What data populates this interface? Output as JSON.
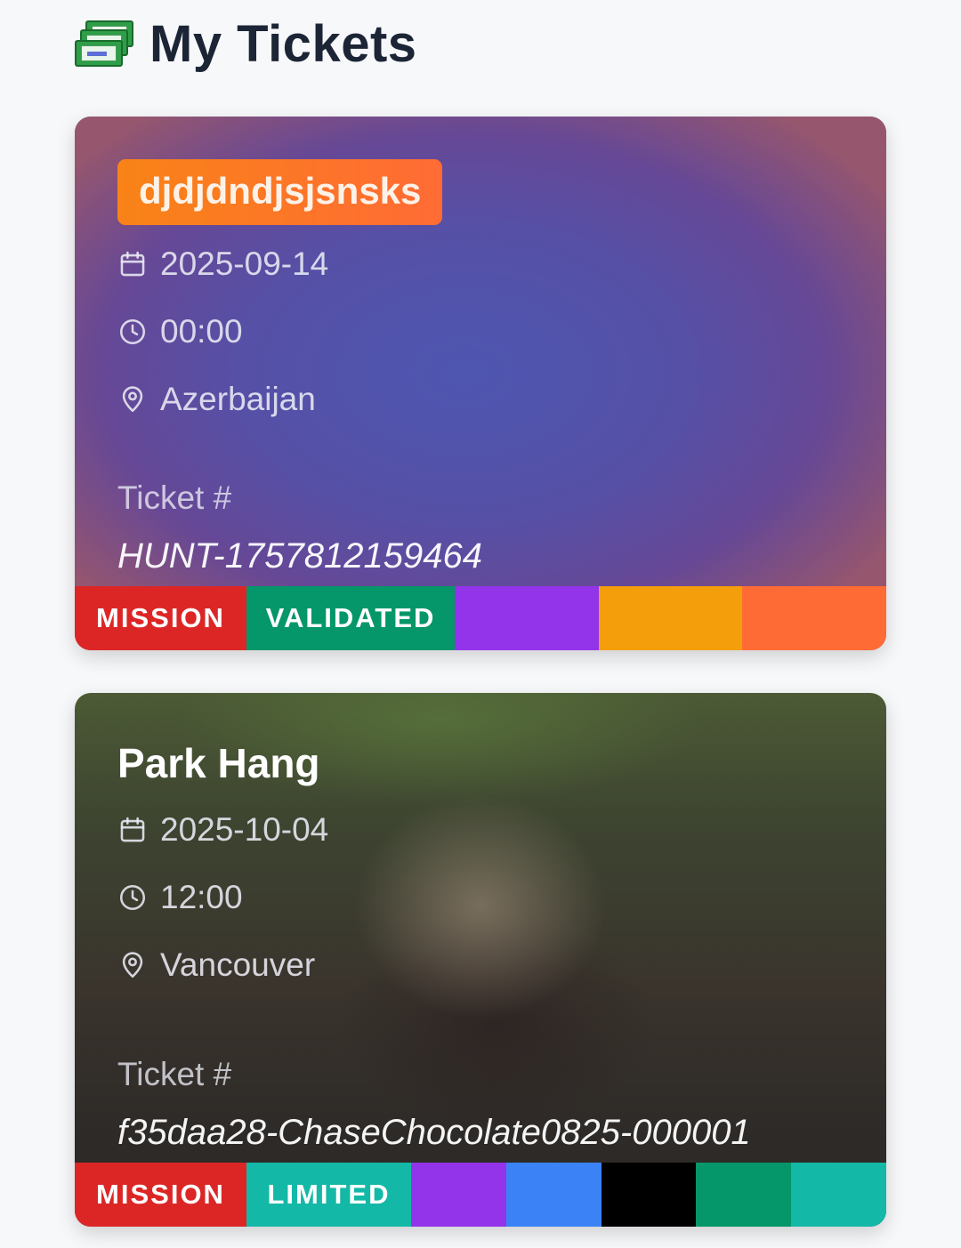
{
  "header": {
    "title": "My Tickets",
    "icon": "money-bills-icon"
  },
  "tickets": [
    {
      "title": "djdjdndjsjsnsks",
      "title_style": "badge",
      "date": "2025-09-14",
      "time": "00:00",
      "location": "Azerbaijan",
      "ticket_label": "Ticket #",
      "ticket_number": "HUNT-1757812159464",
      "tags": [
        {
          "label": "MISSION",
          "color": "#dc2626"
        },
        {
          "label": "VALIDATED",
          "color": "#059669"
        }
      ],
      "swatches": [
        "#9333ea",
        "#f59e0b",
        "#ff6b35"
      ]
    },
    {
      "title": "Park Hang",
      "title_style": "plain",
      "date": "2025-10-04",
      "time": "12:00",
      "location": "Vancouver",
      "ticket_label": "Ticket #",
      "ticket_number": "f35daa28-ChaseChocolate0825-000001",
      "tags": [
        {
          "label": "MISSION",
          "color": "#dc2626"
        },
        {
          "label": "LIMITED",
          "color": "#14b8a6"
        }
      ],
      "swatches": [
        "#9333ea",
        "#3b82f6",
        "#000000",
        "#059669",
        "#14b8a6"
      ]
    }
  ]
}
